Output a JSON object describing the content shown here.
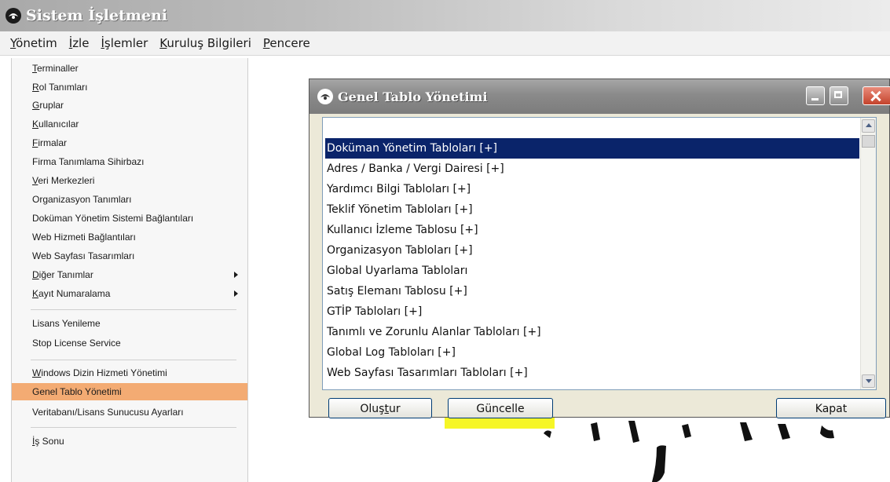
{
  "app": {
    "title": "Sistem İşletmeni"
  },
  "menubar": {
    "items": [
      {
        "first": "Y",
        "rest": "önetim"
      },
      {
        "first": "İ",
        "rest": "zle"
      },
      {
        "first": "İ",
        "rest": "şlemler"
      },
      {
        "first": "K",
        "rest": "uruluş Bilgileri"
      },
      {
        "first": "P",
        "rest": "encere"
      }
    ]
  },
  "dropdown": {
    "items": [
      {
        "first": "T",
        "rest": "erminaller"
      },
      {
        "first": "R",
        "rest": "ol Tanımları"
      },
      {
        "first": "G",
        "rest": "ruplar"
      },
      {
        "first": "K",
        "rest": "ullanıcılar"
      },
      {
        "first": "F",
        "rest": "irmalar"
      },
      {
        "first": "",
        "rest": "Firma Tanımlama Sihirbazı"
      },
      {
        "first": "V",
        "rest": "eri Merkezleri"
      },
      {
        "first": "",
        "rest": "Organizasyon Tanımları"
      },
      {
        "first": "",
        "rest": "Doküman Yönetim Sistemi Bağlantıları"
      },
      {
        "first": "",
        "rest": "Web Hizmeti Bağlantıları"
      },
      {
        "first": "",
        "rest": "Web Sayfası Tasarımları"
      },
      {
        "first": "D",
        "rest": "iğer Tanımlar"
      },
      {
        "first": "K",
        "rest": "ayıt Numaralama"
      },
      {
        "first": "",
        "rest": "Lisans Yenileme"
      },
      {
        "first": "",
        "rest": "Stop License Service"
      },
      {
        "first": "W",
        "rest": "indows Dizin Hizmeti Yönetimi"
      },
      {
        "first": "",
        "rest": "Genel Tablo Yönetimi"
      },
      {
        "first": "",
        "rest": "Veritabanı/Lisans Sunucusu Ayarları"
      },
      {
        "first": "İ",
        "rest": "ş Sonu"
      }
    ]
  },
  "dialog": {
    "title": "Genel Tablo Yönetimi",
    "list_items": [
      "",
      "Doküman Yönetim Tabloları [+]",
      "Adres / Banka / Vergi Dairesi [+]",
      "Yardımcı Bilgi Tabloları [+]",
      "Teklif Yönetim Tabloları [+]",
      "Kullanıcı İzleme Tablosu [+]",
      "Organizasyon Tabloları [+]",
      "Global Uyarlama Tabloları",
      "Satış Elemanı Tablosu [+]",
      "GTİP Tabloları [+]",
      "Tanımlı ve Zorunlu Alanlar Tabloları [+]",
      "Global Log Tabloları [+]",
      "Web Sayfası Tasarımları Tabloları [+]"
    ],
    "buttons": {
      "olustur": {
        "pre": "Oluş",
        "ul": "t",
        "post": "ur"
      },
      "guncelle": "Güncelle",
      "kapat": "Kapat"
    }
  },
  "colors": {
    "menu_selected": "#f3ab73",
    "list_selected": "#0a246a",
    "highlight": "#f4f400"
  }
}
